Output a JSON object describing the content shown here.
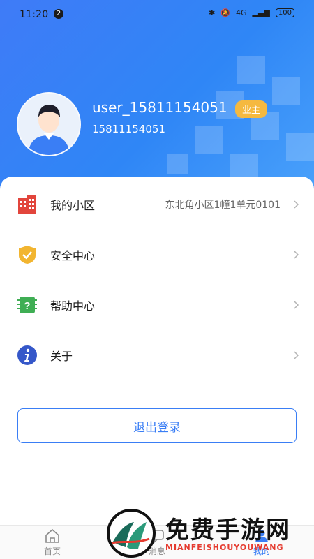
{
  "status": {
    "time": "11:20",
    "notification_count": "2",
    "network": "4G",
    "battery": "100"
  },
  "profile": {
    "username": "user_15811154051",
    "badge": "业主",
    "phone": "15811154051"
  },
  "menu": [
    {
      "label": "我的小区",
      "value": "东北角小区1幢1单元0101",
      "icon": "building-icon"
    },
    {
      "label": "安全中心",
      "value": "",
      "icon": "shield-check-icon"
    },
    {
      "label": "帮助中心",
      "value": "",
      "icon": "help-icon"
    },
    {
      "label": "关于",
      "value": "",
      "icon": "info-icon"
    }
  ],
  "logout_label": "退出登录",
  "tabs": [
    {
      "label": "首页",
      "icon": "home-icon"
    },
    {
      "label": "消息",
      "icon": "message-icon"
    },
    {
      "label": "我的",
      "icon": "profile-icon"
    }
  ],
  "watermark": {
    "title": "免费手游网",
    "subtitle": "MIANFEISHOUYOUWANG"
  },
  "colors": {
    "primary": "#3a7ef5",
    "badge": "#f5b940"
  }
}
